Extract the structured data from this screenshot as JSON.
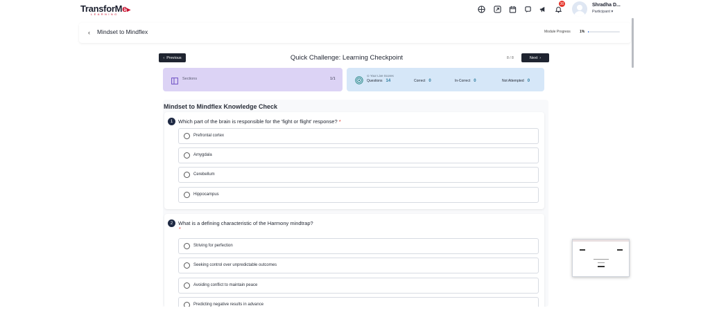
{
  "nav": {
    "logo_main": "TransforM",
    "logo_accent": "e",
    "logo_sub": "LEARNING",
    "notification_count": "30",
    "user_name": "Shradha D...",
    "user_role": "Participant ▾"
  },
  "module": {
    "title": "Mindset to Mindflex",
    "progress_label": "Module Progress",
    "progress_value": "1%",
    "progress_fraction": 0.01
  },
  "quiz": {
    "prev_label": "Previous",
    "next_label": "Next",
    "title": "Quick Challenge: Learning Checkpoint",
    "page_count": "8 / 8",
    "sections_label": "Sections",
    "sections_count": "1/1",
    "scores_label": "Your Live Scores",
    "scores": {
      "questions_label": "Questions",
      "questions_value": "14",
      "correct_label": "Correct",
      "correct_value": "0",
      "incorrect_label": "In-Correct",
      "incorrect_value": "0",
      "not_attempted_label": "Not Attempted",
      "not_attempted_value": "0"
    },
    "heading": "Mindset to Mindflex Knowledge Check",
    "questions": [
      {
        "number": "1",
        "text": "Which part of the brain is responsible for the 'fight or flight' response?",
        "required_mark": "*",
        "options": [
          "Prefrontal cortex",
          "Amygdala",
          "Cerebellum",
          "Hippocampus"
        ]
      },
      {
        "number": "2",
        "text": "What is a defining characteristic of the Harmony mindtrap?",
        "required_mark": "*",
        "options": [
          "Striving for perfection",
          "Seeking control over unpredictable outcomes",
          "Avoiding conflict to maintain peace",
          "Predicting negative results in advance"
        ]
      }
    ]
  },
  "colors": {
    "accent_dark": "#1f2430",
    "sections_bg": "#dcd3f5",
    "scores_bg": "#d6e7f8",
    "badge_red": "#e5342a"
  },
  "icons": [
    "globe-icon",
    "external-link-icon",
    "calendar-icon",
    "chat-icon",
    "megaphone-icon",
    "bell-icon",
    "sections-icon",
    "target-icon",
    "chevron-left-icon",
    "chevron-right-icon"
  ]
}
